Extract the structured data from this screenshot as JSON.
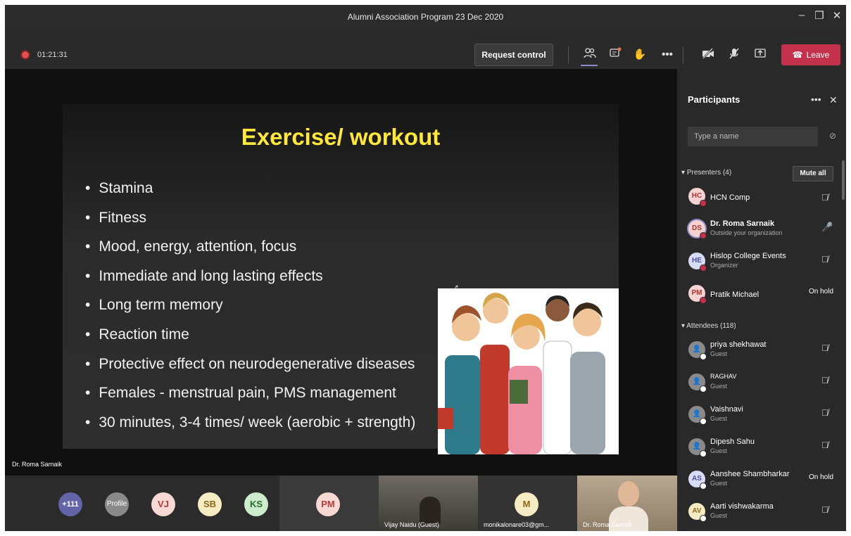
{
  "window": {
    "title": "Alumni Association Program 23 Dec 2020"
  },
  "meeting": {
    "timer": "01:21:31",
    "request_control": "Request control",
    "leave": "Leave"
  },
  "slide": {
    "title": "Exercise/ workout",
    "bullets": [
      "Stamina",
      "Fitness",
      "Mood, energy, attention, focus",
      "Immediate and long lasting effects",
      "Long term memory",
      "Reaction time",
      "Protective effect on neurodegenerative diseases",
      "Females - menstrual pain, PMS management",
      "30 minutes, 3-4 times/ week (aerobic + strength)"
    ]
  },
  "stage": {
    "speaker": "Dr. Roma Sarnaik"
  },
  "strip": {
    "overflow": "+111",
    "profile": "Profile",
    "avatars": [
      "VJ",
      "SB",
      "KS"
    ],
    "pm": "PM",
    "video1": "Vijay Naidu (Guest)",
    "m": "M",
    "mlabel": "monikalonare03@gm...",
    "video2": "Dr. Roma Sarnaik"
  },
  "panel": {
    "title": "Participants",
    "search_placeholder": "Type a name",
    "presenters_header": "Presenters (4)",
    "mute_all": "Mute all",
    "attendees_header": "Attendees (118)",
    "presenters": [
      {
        "initials": "HC",
        "name": "HCN Comp",
        "sub": "",
        "status": "",
        "color": "#f6d3d3"
      },
      {
        "initials": "DS",
        "name": "Dr. Roma Sarnaik",
        "sub": "Outside your organization",
        "status": "",
        "color": "#f6d3d3"
      },
      {
        "initials": "HE",
        "name": "Hislop College Events",
        "sub": "Organizer",
        "status": "",
        "color": "#d9dcf6"
      },
      {
        "initials": "PM",
        "name": "Pratik Michael",
        "sub": "",
        "status": "On hold",
        "color": "#f6d3d3"
      }
    ],
    "attendees": [
      {
        "initials": "",
        "name": "priya shekhawat",
        "sub": "Guest",
        "status": ""
      },
      {
        "initials": "",
        "name": "RAGHAV",
        "sub": "Guest",
        "status": ""
      },
      {
        "initials": "",
        "name": "Vaishnavi",
        "sub": "Guest",
        "status": ""
      },
      {
        "initials": "",
        "name": "Dipesh Sahu",
        "sub": "Guest",
        "status": ""
      },
      {
        "initials": "AS",
        "name": "Aanshee Shambharkar",
        "sub": "Guest",
        "status": "On hold"
      },
      {
        "initials": "AV",
        "name": "Aarti vishwakarma",
        "sub": "Guest",
        "status": ""
      }
    ]
  }
}
